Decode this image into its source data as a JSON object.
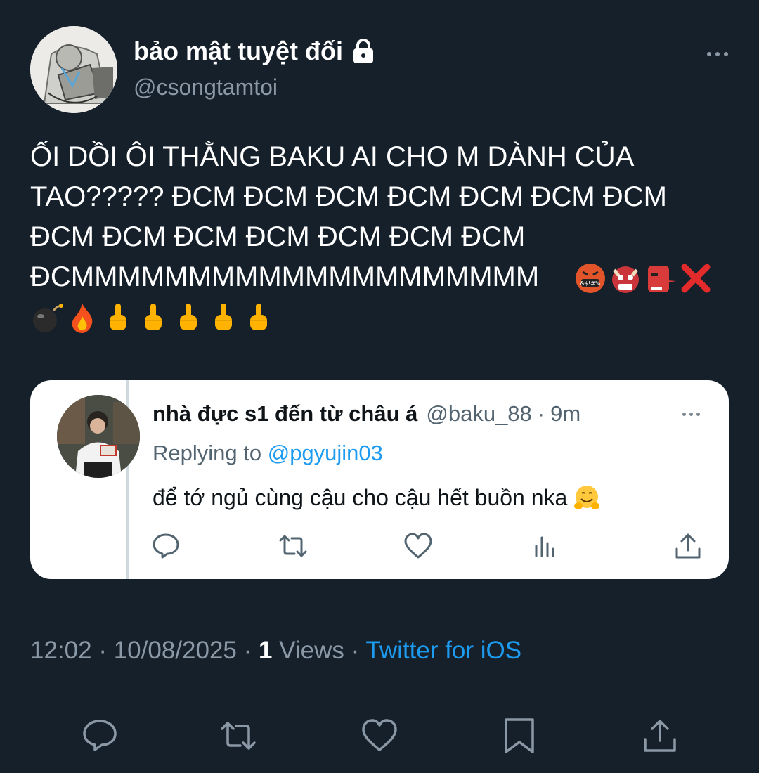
{
  "author": {
    "display_name": "bảo mật tuyệt đối",
    "handle": "@csongtamtoi",
    "lock_icon": "lock-icon"
  },
  "tweet": {
    "text": "ỐI DỒI ÔI THẰNG BAKU AI CHO M DÀNH CỦA TAO????? ĐCM ĐCM ĐCM ĐCM ĐCM ĐCM ĐCM ĐCM ĐCM ĐCM ĐCM ĐCM ĐCM ĐCM ĐCMMMMMMMMMMMMMMMMMMMM",
    "emojis": [
      "cursing-face-emoji",
      "ogre-emoji",
      "goblin-emoji",
      "cross-mark-emoji",
      "bomb-emoji",
      "fire-emoji",
      "middle-finger-emoji",
      "middle-finger-emoji",
      "middle-finger-emoji",
      "middle-finger-emoji",
      "middle-finger-emoji"
    ]
  },
  "quote": {
    "name": "nhà đực s1 đến từ châu á",
    "handle": "@baku_88",
    "separator": "·",
    "time": "9m",
    "replying_prefix": "Replying to ",
    "replying_to": "@pgyujin03",
    "text": "để tớ ngủ cùng cậu cho cậu hết buồn nka",
    "text_emoji": "hugging-face-emoji"
  },
  "meta": {
    "time": "12:02",
    "sep1": " · ",
    "date": "10/08/2025",
    "sep2": " · ",
    "views_count": "1",
    "views_label": " Views",
    "sep3": " · ",
    "source": "Twitter for iOS"
  },
  "colors": {
    "background": "#15202b",
    "accent": "#1d9bf0",
    "secondary_text": "#8b98a5"
  }
}
